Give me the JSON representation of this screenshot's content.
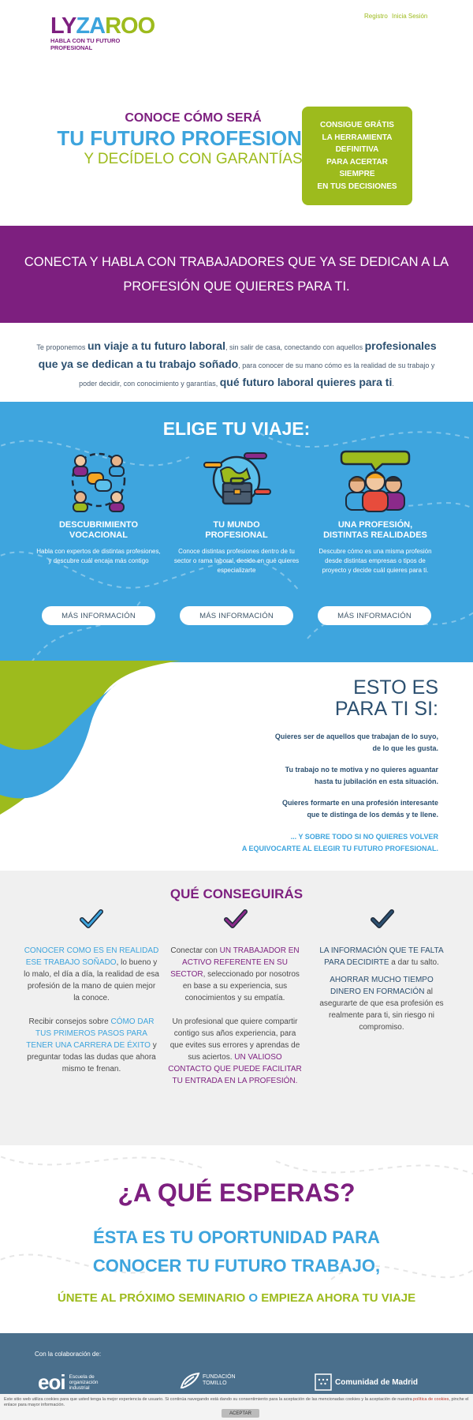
{
  "header": {
    "logo": {
      "ly": "LY",
      "za": "ZA",
      "roo": "R",
      "o2": "O",
      "o3": "O",
      "tagline": "HABLA CON TU FUTURO PROFESIONAL"
    },
    "nav": [
      "Registro",
      "Inicia Sesión"
    ]
  },
  "hero": {
    "line1": "CONOCE CÓMO SERÁ",
    "line2": "TU FUTURO PROFESIONAL",
    "line3": "Y DECÍDELO CON GARANTÍAS",
    "cta_lines": [
      "CONSIGUE GRÁTIS",
      "LA HERRAMIENTA",
      "DEFINITIVA",
      "PARA ACERTAR",
      "SIEMPRE",
      "EN TUS DECISIONES"
    ]
  },
  "band": {
    "line1": "CONECTA Y HABLA CON TRABAJADORES QUE YA SE DEDICAN A LA",
    "line2": "PROFESIÓN QUE QUIERES PARA TI."
  },
  "intro": {
    "t1": "Te proponemos ",
    "b1": "un viaje a tu futuro laboral",
    "t2": ", sin salir de casa, conectando con aquellos ",
    "b2": "profesionales que ya se dedican a tu trabajo soñado",
    "t3": ", para conocer de su mano cómo es la realidad de su trabajo y poder decidir, con conocimiento y garantías, ",
    "b3": "qué futuro laboral quieres para ti",
    "t4": "."
  },
  "elige": {
    "title": "ELIGE TU VIAJE:",
    "columns": [
      {
        "icon": "chat-people-icon",
        "title_1": "DESCUBRIMIENTO",
        "title_2": "VOCACIONAL",
        "desc_1": "Habla con expertos de distintas profesiones,",
        "desc_2": "y descubre cuál encaja más contigo",
        "desc_3": "",
        "button": "MÁS INFORMACIÓN"
      },
      {
        "icon": "globe-briefcase-icon",
        "title_1": "TU MUNDO",
        "title_2": "PROFESIONAL",
        "desc_1": "Conoce distintas profesiones dentro de tu",
        "desc_2": "sector o rama laboral, decide en qué quieres",
        "desc_3": "especializarte",
        "button": "MÁS INFORMACIÓN"
      },
      {
        "icon": "group-people-icon",
        "title_1": "UNA PROFESIÓN,",
        "title_2": "DISTINTAS REALIDADES",
        "desc_1": "Descubre cómo es una misma profesión",
        "desc_2": "desde distintas empresas o tipos de",
        "desc_3": "proyecto y decide cuál quieres para ti.",
        "button": "MÁS INFORMACIÓN"
      }
    ]
  },
  "esto": {
    "title_1": "ESTO ES",
    "title_2": "PARA TI SI:",
    "items": [
      {
        "l1": "Quieres ser de aquellos que trabajan de lo suyo,",
        "l2": "de lo que les gusta."
      },
      {
        "l1": "Tu trabajo no te motiva y no quieres aguantar",
        "l2": "hasta tu jubilación en esta situación."
      },
      {
        "l1": "Quieres formarte en una profesión interesante",
        "l2": "que te distinga de los demás y te llene."
      },
      {
        "l1": "... Y SOBRE TODO SI NO QUIERES VOLVER",
        "l2": "A EQUIVOCARTE AL ELEGIR TU FUTURO PROFESIONAL."
      }
    ]
  },
  "consigue": {
    "title": "QUÉ CONSEGUIRÁS",
    "col1": {
      "a_blue": "CONOCER COMO ES EN REALIDAD ESE TRABAJO SOÑADO",
      "a_rest": ", lo bueno y lo malo, el día a día, la realidad de esa profesión de la mano de quien mejor la conoce.",
      "b_pre": "Recibir consejos sobre ",
      "b_blue": "CÓMO DAR TUS PRIMEROS PASOS PARA TENER UNA CARRERA DE ÉXITO",
      "b_rest": " y preguntar todas las dudas que ahora mismo te frenan."
    },
    "col2": {
      "a_pre": "Conectar con ",
      "a_purple": "UN TRABAJADOR EN ACTIVO REFERENTE EN SU SECTOR",
      "a_rest": ", seleccionado por nosotros en base a su experiencia, sus conocimientos y su empatía.",
      "b_rest": "Un profesional que quiere compartir contigo sus años experiencia, para que evites sus errores y aprendas de sus aciertos. ",
      "b_purple": "UN VALIOSO CONTACTO QUE PUEDE FACILITAR TU ENTRADA EN LA PROFESIÓN."
    },
    "col3": {
      "a_navy": "LA INFORMACIÓN QUE TE FALTA PARA DECIDIRTE",
      "a_rest": " a dar tu salto.",
      "b_navy": "AHORRAR MUCHO TIEMPO DINERO EN FORMACIÓN",
      "b_rest": " al asegurarte de que esa profesión es realmente para ti, sin riesgo ni compromiso."
    }
  },
  "espera": {
    "title": "¿A QUÉ ESPERAS?",
    "op1": "ÉSTA ES TU OPORTUNIDAD PARA",
    "op2": "CONOCER TU FUTURO TRABAJO,",
    "u1": "ÚNETE AL PRÓXIMO SEMINARIO ",
    "u2": "O",
    "u3": " EMPIEZA AHORA TU VIAJE"
  },
  "footer": {
    "collab": "Con la colaboración de:",
    "eoi_mark": "eoi",
    "eoi_1": "Escuela de",
    "eoi_2": "organización",
    "eoi_3": "industrial",
    "tomillo_1": "FUNDACIÓN",
    "tomillo_2": "TOMILLO",
    "madrid": "Comunidad de Madrid"
  },
  "cookie": {
    "text": "Este sitio web utiliza cookies para que usted tenga la mejor experiencia de usuario. Si continúa navegando está dando su consentimiento para la aceptación de las mencionadas cookies y la aceptación de nuestra",
    "link": "política de cookies",
    "text2": ", pinche el enlace para mayor información.",
    "button": "ACEPTAR"
  },
  "colors": {
    "purple": "#7d1f7f",
    "blue": "#3da4dd",
    "green": "#9dbb1d",
    "navy": "#2c5070",
    "footer": "#4a6f8c"
  }
}
